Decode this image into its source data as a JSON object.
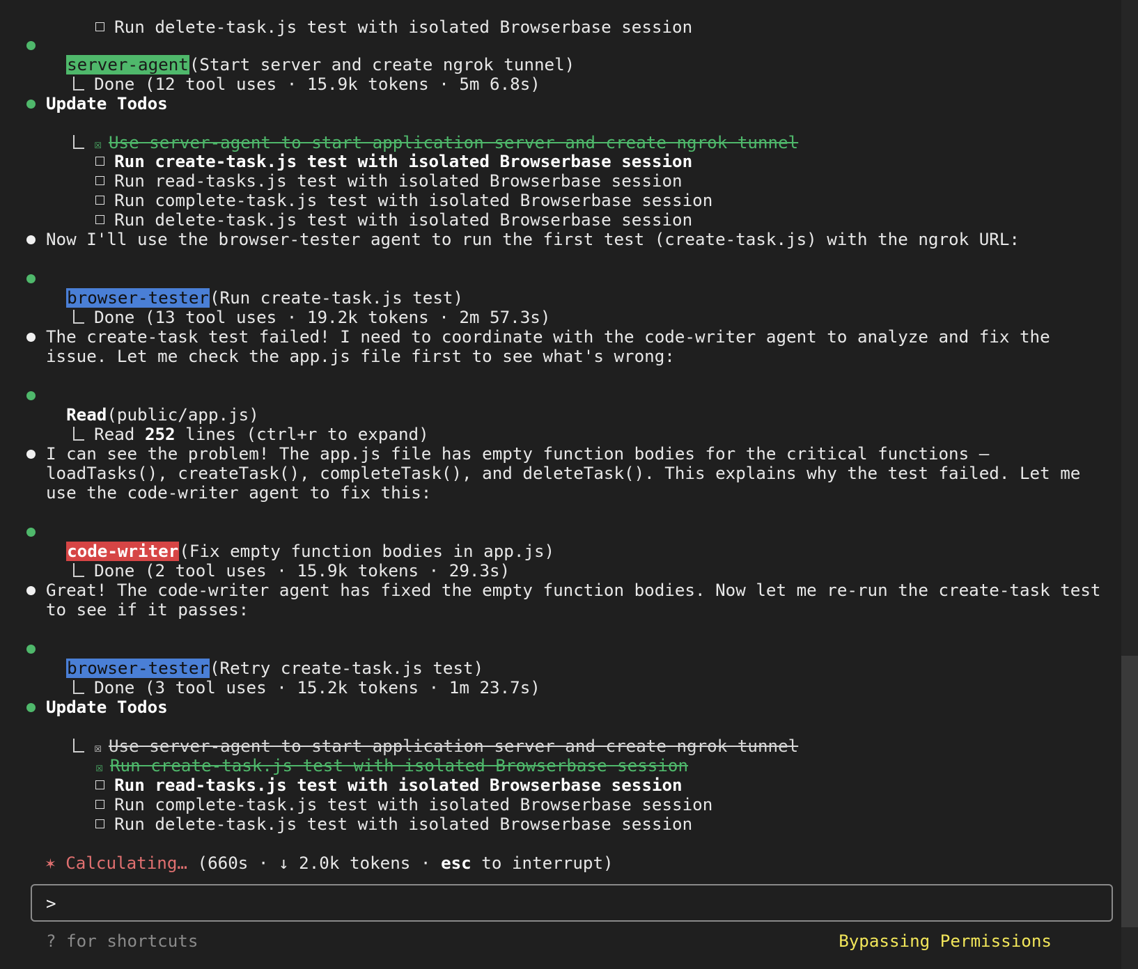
{
  "top": {
    "todo": "Run delete-task.js test with isolated Browserbase session"
  },
  "server_agent": {
    "tag": "server-agent",
    "desc": "(Start server and create ngrok tunnel)",
    "result": "Done (12 tool uses · 15.9k tokens · 5m 6.8s)"
  },
  "todos1": {
    "title": "Update Todos",
    "items": [
      "Use server-agent to start application server and create ngrok tunnel",
      "Run create-task.js test with isolated Browserbase session",
      "Run read-tasks.js test with isolated Browserbase session",
      "Run complete-task.js test with isolated Browserbase session",
      "Run delete-task.js test with isolated Browserbase session"
    ]
  },
  "msg1": "Now I'll use the browser-tester agent to run the first test (create-task.js) with the ngrok URL:",
  "browser_tester1": {
    "tag": "browser-tester",
    "desc": "(Run create-task.js test)",
    "result": "Done (13 tool uses · 19.2k tokens · 2m 57.3s)"
  },
  "msg2": {
    "line1": "The create-task test failed! I need to coordinate with the code-writer agent to analyze and fix the",
    "line2": "issue. Let me check the app.js file first to see what's wrong:"
  },
  "read": {
    "tool": "Read",
    "arg": "(public/app.js)",
    "prefix": "Read ",
    "count": "252",
    "suffix": " lines (ctrl+r to expand)"
  },
  "msg3": {
    "line1": "I can see the problem! The app.js file has empty function bodies for the critical functions –",
    "line2": "loadTasks(), createTask(), completeTask(), and deleteTask(). This explains why the test failed. Let me",
    "line3": "use the code-writer agent to fix this:"
  },
  "code_writer": {
    "tag": "code-writer",
    "desc": "(Fix empty function bodies in app.js)",
    "result": "Done (2 tool uses · 15.9k tokens · 29.3s)"
  },
  "msg4": {
    "line1": "Great! The code-writer agent has fixed the empty function bodies. Now let me re-run the create-task test",
    "line2": "to see if it passes:"
  },
  "browser_tester2": {
    "tag": "browser-tester",
    "desc": "(Retry create-task.js test)",
    "result": "Done (3 tool uses · 15.2k tokens · 1m 23.7s)"
  },
  "todos2": {
    "title": "Update Todos",
    "items": [
      "Use server-agent to start application server and create ngrok tunnel",
      "Run create-task.js test with isolated Browserbase session",
      "Run read-tasks.js test with isolated Browserbase session",
      "Run complete-task.js test with isolated Browserbase session",
      "Run delete-task.js test with isolated Browserbase session"
    ]
  },
  "status": {
    "star": "✶",
    "label": "Calculating…",
    "open": " (660s · ↓ 2.0k tokens · ",
    "esc": "esc",
    "close": " to interrupt)"
  },
  "input": {
    "prompt": ">"
  },
  "footer": {
    "shortcuts": "? for shortcuts",
    "mode": "Bypassing Permissions"
  },
  "colors": {
    "green": "#4fb86b",
    "blue": "#4a7fd6",
    "red": "#d64545",
    "yellow": "#f2e65a",
    "background": "#1f1f1f"
  }
}
